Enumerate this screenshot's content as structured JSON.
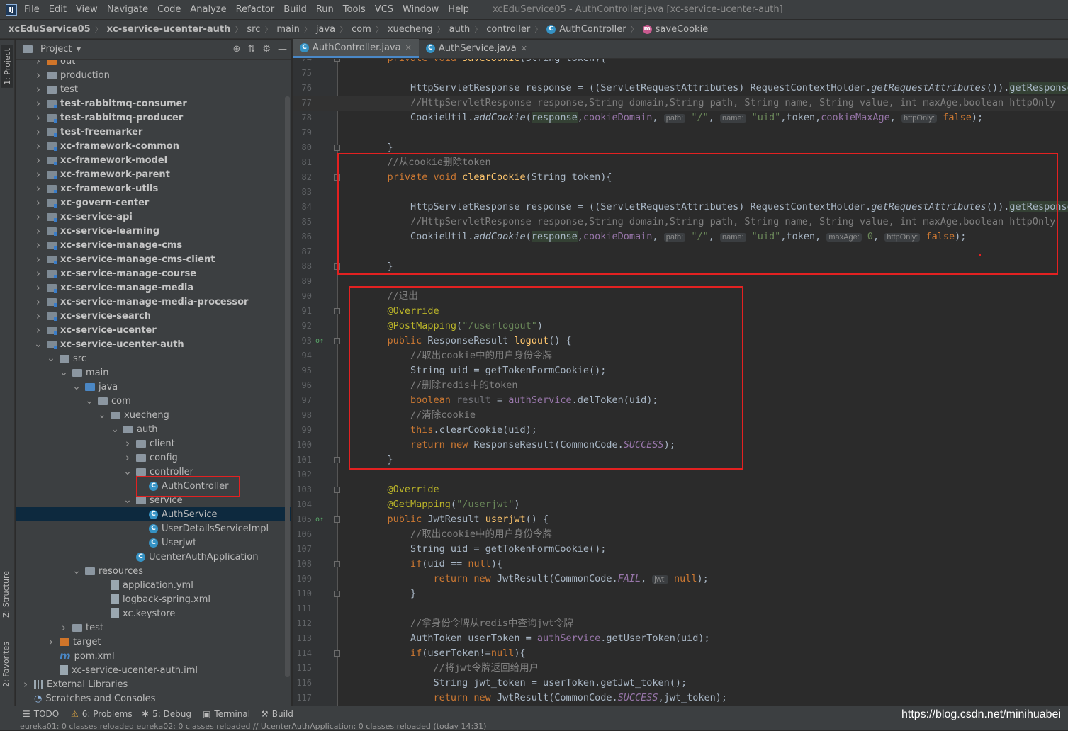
{
  "menubar": {
    "items": [
      "File",
      "Edit",
      "View",
      "Navigate",
      "Code",
      "Analyze",
      "Refactor",
      "Build",
      "Run",
      "Tools",
      "VCS",
      "Window",
      "Help"
    ],
    "window_title": "xcEduService05 - AuthController.java [xc-service-ucenter-auth]"
  },
  "breadcrumb": [
    "xcEduService05",
    "xc-service-ucenter-auth",
    "src",
    "main",
    "java",
    "com",
    "xuecheng",
    "auth",
    "controller",
    "AuthController",
    "saveCookie"
  ],
  "side_tabs": {
    "project": "1: Project",
    "structure": "Z: Structure",
    "favorites": "2: Favorites"
  },
  "project_panel": {
    "title": "Project"
  },
  "tree": [
    {
      "label": "out",
      "depth": 1,
      "icon": "orange",
      "arrow": ">"
    },
    {
      "label": "production",
      "depth": 1,
      "icon": "folder",
      "arrow": ">"
    },
    {
      "label": "test",
      "depth": 1,
      "icon": "folder",
      "arrow": ">"
    },
    {
      "label": "test-rabbitmq-consumer",
      "depth": 1,
      "icon": "mod",
      "arrow": ">",
      "bold": true
    },
    {
      "label": "test-rabbitmq-producer",
      "depth": 1,
      "icon": "mod",
      "arrow": ">",
      "bold": true
    },
    {
      "label": "test-freemarker",
      "depth": 1,
      "icon": "mod",
      "arrow": ">",
      "bold": true
    },
    {
      "label": "xc-framework-common",
      "depth": 1,
      "icon": "mod",
      "arrow": ">",
      "bold": true
    },
    {
      "label": "xc-framework-model",
      "depth": 1,
      "icon": "mod",
      "arrow": ">",
      "bold": true
    },
    {
      "label": "xc-framework-parent",
      "depth": 1,
      "icon": "mod",
      "arrow": ">",
      "bold": true
    },
    {
      "label": "xc-framework-utils",
      "depth": 1,
      "icon": "mod",
      "arrow": ">",
      "bold": true
    },
    {
      "label": "xc-govern-center",
      "depth": 1,
      "icon": "mod",
      "arrow": ">",
      "bold": true
    },
    {
      "label": "xc-service-api",
      "depth": 1,
      "icon": "mod",
      "arrow": ">",
      "bold": true
    },
    {
      "label": "xc-service-learning",
      "depth": 1,
      "icon": "mod",
      "arrow": ">",
      "bold": true
    },
    {
      "label": "xc-service-manage-cms",
      "depth": 1,
      "icon": "mod",
      "arrow": ">",
      "bold": true
    },
    {
      "label": "xc-service-manage-cms-client",
      "depth": 1,
      "icon": "mod",
      "arrow": ">",
      "bold": true
    },
    {
      "label": "xc-service-manage-course",
      "depth": 1,
      "icon": "mod",
      "arrow": ">",
      "bold": true
    },
    {
      "label": "xc-service-manage-media",
      "depth": 1,
      "icon": "mod",
      "arrow": ">",
      "bold": true
    },
    {
      "label": "xc-service-manage-media-processor",
      "depth": 1,
      "icon": "mod",
      "arrow": ">",
      "bold": true
    },
    {
      "label": "xc-service-search",
      "depth": 1,
      "icon": "mod",
      "arrow": ">",
      "bold": true
    },
    {
      "label": "xc-service-ucenter",
      "depth": 1,
      "icon": "mod",
      "arrow": ">",
      "bold": true
    },
    {
      "label": "xc-service-ucenter-auth",
      "depth": 1,
      "icon": "mod",
      "arrow": "v",
      "bold": true
    },
    {
      "label": "src",
      "depth": 2,
      "icon": "folder",
      "arrow": "v"
    },
    {
      "label": "main",
      "depth": 3,
      "icon": "folder",
      "arrow": "v"
    },
    {
      "label": "java",
      "depth": 4,
      "icon": "src",
      "arrow": "v"
    },
    {
      "label": "com",
      "depth": 5,
      "icon": "folder",
      "arrow": "v"
    },
    {
      "label": "xuecheng",
      "depth": 6,
      "icon": "folder",
      "arrow": "v"
    },
    {
      "label": "auth",
      "depth": 7,
      "icon": "folder",
      "arrow": "v"
    },
    {
      "label": "client",
      "depth": 8,
      "icon": "folder",
      "arrow": ">"
    },
    {
      "label": "config",
      "depth": 8,
      "icon": "folder",
      "arrow": ">"
    },
    {
      "label": "controller",
      "depth": 8,
      "icon": "folder",
      "arrow": "v"
    },
    {
      "label": "AuthController",
      "depth": 9,
      "icon": "class",
      "arrow": ""
    },
    {
      "label": "service",
      "depth": 8,
      "icon": "folder",
      "arrow": "v"
    },
    {
      "label": "AuthService",
      "depth": 9,
      "icon": "class",
      "arrow": "",
      "selected": true
    },
    {
      "label": "UserDetailsServiceImpl",
      "depth": 9,
      "icon": "class",
      "arrow": ""
    },
    {
      "label": "UserJwt",
      "depth": 9,
      "icon": "class",
      "arrow": ""
    },
    {
      "label": "UcenterAuthApplication",
      "depth": 8,
      "icon": "class",
      "arrow": ""
    },
    {
      "label": "resources",
      "depth": 4,
      "icon": "res",
      "arrow": "v"
    },
    {
      "label": "application.yml",
      "depth": 6,
      "icon": "file",
      "arrow": ""
    },
    {
      "label": "logback-spring.xml",
      "depth": 6,
      "icon": "file",
      "arrow": ""
    },
    {
      "label": "xc.keystore",
      "depth": 6,
      "icon": "file",
      "arrow": ""
    },
    {
      "label": "test",
      "depth": 3,
      "icon": "folder",
      "arrow": ">"
    },
    {
      "label": "target",
      "depth": 2,
      "icon": "orange",
      "arrow": ">"
    },
    {
      "label": "pom.xml",
      "depth": 2,
      "icon": "maven",
      "arrow": ""
    },
    {
      "label": "xc-service-ucenter-auth.iml",
      "depth": 2,
      "icon": "file",
      "arrow": ""
    },
    {
      "label": "External Libraries",
      "depth": 0,
      "icon": "lib",
      "arrow": ">"
    },
    {
      "label": "Scratches and Consoles",
      "depth": 0,
      "icon": "scratch",
      "arrow": ""
    }
  ],
  "editor_tabs": [
    {
      "label": "AuthController.java",
      "active": true
    },
    {
      "label": "AuthService.java",
      "active": false
    }
  ],
  "code": {
    "first_line": 74,
    "lines": [
      [
        [
          "kw",
          "    private void "
        ],
        [
          "fn",
          "saveCookie"
        ],
        [
          "",
          "(String token){"
        ]
      ],
      [],
      [
        [
          "",
          "        HttpServletResponse response = ((ServletRequestAttributes) RequestContextHolder."
        ],
        [
          "it",
          "getRequestAttributes"
        ],
        [
          "",
          "())."
        ],
        [
          "hl",
          "getResponse"
        ],
        [
          "",
          "();"
        ]
      ],
      [
        [
          "cm",
          "        //HttpServletResponse response,String domain,String path, String name, String value, int maxAge,boolean httpOnly"
        ]
      ],
      [
        [
          "",
          "        CookieUtil."
        ],
        [
          "it",
          "addCookie"
        ],
        [
          "",
          "("
        ],
        [
          "hl",
          "response"
        ],
        [
          "",
          ","
        ],
        [
          "fld",
          "cookieDomain"
        ],
        [
          "",
          ", "
        ],
        [
          "hint",
          "path:"
        ],
        [
          "str",
          " \"/\""
        ],
        [
          "",
          ", "
        ],
        [
          "hint",
          "name:"
        ],
        [
          "str",
          " \"uid\""
        ],
        [
          "",
          ",token,"
        ],
        [
          "fld",
          "cookieMaxAge"
        ],
        [
          "",
          ", "
        ],
        [
          "hint",
          "httpOnly:"
        ],
        [
          "kw",
          " false"
        ],
        [
          "",
          ");"
        ]
      ],
      [],
      [
        [
          "",
          "    }"
        ]
      ],
      [
        [
          "cm",
          "    //从cookie删除token"
        ]
      ],
      [
        [
          "kw",
          "    private void "
        ],
        [
          "fn",
          "clearCookie"
        ],
        [
          "",
          "(String token){"
        ]
      ],
      [],
      [
        [
          "",
          "        HttpServletResponse response = ((ServletRequestAttributes) RequestContextHolder."
        ],
        [
          "it",
          "getRequestAttributes"
        ],
        [
          "",
          "())."
        ],
        [
          "hl",
          "getResponse"
        ],
        [
          "",
          "();"
        ]
      ],
      [
        [
          "cm",
          "        //HttpServletResponse response,String domain,String path, String name, String value, int maxAge,boolean httpOnly"
        ]
      ],
      [
        [
          "",
          "        CookieUtil."
        ],
        [
          "it",
          "addCookie"
        ],
        [
          "",
          "("
        ],
        [
          "hl",
          "response"
        ],
        [
          "",
          ","
        ],
        [
          "fld",
          "cookieDomain"
        ],
        [
          "",
          ", "
        ],
        [
          "hint",
          "path:"
        ],
        [
          "str",
          " \"/\""
        ],
        [
          "",
          ", "
        ],
        [
          "hint",
          "name:"
        ],
        [
          "str",
          " \"uid\""
        ],
        [
          "",
          ",token, "
        ],
        [
          "hint",
          "maxAge:"
        ],
        [
          "str",
          " 0"
        ],
        [
          "",
          ", "
        ],
        [
          "hint",
          "httpOnly:"
        ],
        [
          "kw",
          " false"
        ],
        [
          "",
          ");"
        ]
      ],
      [],
      [
        [
          "",
          "    }"
        ]
      ],
      [],
      [
        [
          "cm",
          "    //退出"
        ]
      ],
      [
        [
          "ann",
          "    @Override"
        ]
      ],
      [
        [
          "ann",
          "    @PostMapping"
        ],
        [
          "",
          "("
        ],
        [
          "str",
          "\"/userlogout\""
        ],
        [
          "",
          ")"
        ]
      ],
      [
        [
          "kw",
          "    public "
        ],
        [
          "",
          "ResponseResult "
        ],
        [
          "fn",
          "logout"
        ],
        [
          "",
          "() {"
        ]
      ],
      [
        [
          "cm",
          "        //取出cookie中的用户身份令牌"
        ]
      ],
      [
        [
          "",
          "        String uid = getTokenFormCookie();"
        ]
      ],
      [
        [
          "cm",
          "        //删除redis中的token"
        ]
      ],
      [
        [
          "kw",
          "        boolean "
        ],
        [
          "gray",
          "result"
        ],
        [
          "",
          " = "
        ],
        [
          "fld",
          "authService"
        ],
        [
          "",
          ".delToken(uid);"
        ]
      ],
      [
        [
          "cm",
          "        //清除cookie"
        ]
      ],
      [
        [
          "kw",
          "        this"
        ],
        [
          "",
          ".clearCookie(uid);"
        ]
      ],
      [
        [
          "kw",
          "        return new "
        ],
        [
          "",
          "ResponseResult(CommonCode."
        ],
        [
          "fld it",
          "SUCCESS"
        ],
        [
          "",
          ");"
        ]
      ],
      [
        [
          "",
          "    }"
        ]
      ],
      [],
      [
        [
          "ann",
          "    @Override"
        ]
      ],
      [
        [
          "ann",
          "    @GetMapping"
        ],
        [
          "",
          "("
        ],
        [
          "str",
          "\"/userjwt\""
        ],
        [
          "",
          ")"
        ]
      ],
      [
        [
          "kw",
          "    public "
        ],
        [
          "",
          "JwtResult "
        ],
        [
          "fn",
          "userjwt"
        ],
        [
          "",
          "() {"
        ]
      ],
      [
        [
          "cm",
          "        //取出cookie中的用户身份令牌"
        ]
      ],
      [
        [
          "",
          "        String uid = getTokenFormCookie();"
        ]
      ],
      [
        [
          "kw",
          "        if"
        ],
        [
          "",
          "(uid == "
        ],
        [
          "kw",
          "null"
        ],
        [
          "",
          "){"
        ]
      ],
      [
        [
          "kw",
          "            return new "
        ],
        [
          "",
          "JwtResult(CommonCode."
        ],
        [
          "fld it",
          "FAIL"
        ],
        [
          "",
          ", "
        ],
        [
          "hint",
          "jwt:"
        ],
        [
          "kw",
          " null"
        ],
        [
          "",
          ");"
        ]
      ],
      [
        [
          "",
          "        }"
        ]
      ],
      [],
      [
        [
          "cm",
          "        //拿身份令牌从redis中查询jwt令牌"
        ]
      ],
      [
        [
          "",
          "        AuthToken userToken = "
        ],
        [
          "fld",
          "authService"
        ],
        [
          "",
          ".getUserToken(uid);"
        ]
      ],
      [
        [
          "kw",
          "        if"
        ],
        [
          "",
          "(userToken!="
        ],
        [
          "kw",
          "null"
        ],
        [
          "",
          "){"
        ]
      ],
      [
        [
          "cm",
          "            //将jwt令牌返回给用户"
        ]
      ],
      [
        [
          "",
          "            String jwt_token = userToken.getJwt_token();"
        ]
      ],
      [
        [
          "kw",
          "            return new "
        ],
        [
          "",
          "JwtResult(CommonCode."
        ],
        [
          "fld it",
          "SUCCESS"
        ],
        [
          "",
          ",jwt_token);"
        ]
      ]
    ]
  },
  "statusbar": {
    "tools": [
      "TODO",
      "6: Problems",
      "5: Debug",
      "Terminal",
      "Build"
    ],
    "message": "eureka01: 0 classes reloaded eureka02: 0 classes reloaded // UcenterAuthApplication: 0 classes reloaded (today 14:31)",
    "watermark": "https://blog.csdn.net/minihuabei"
  }
}
